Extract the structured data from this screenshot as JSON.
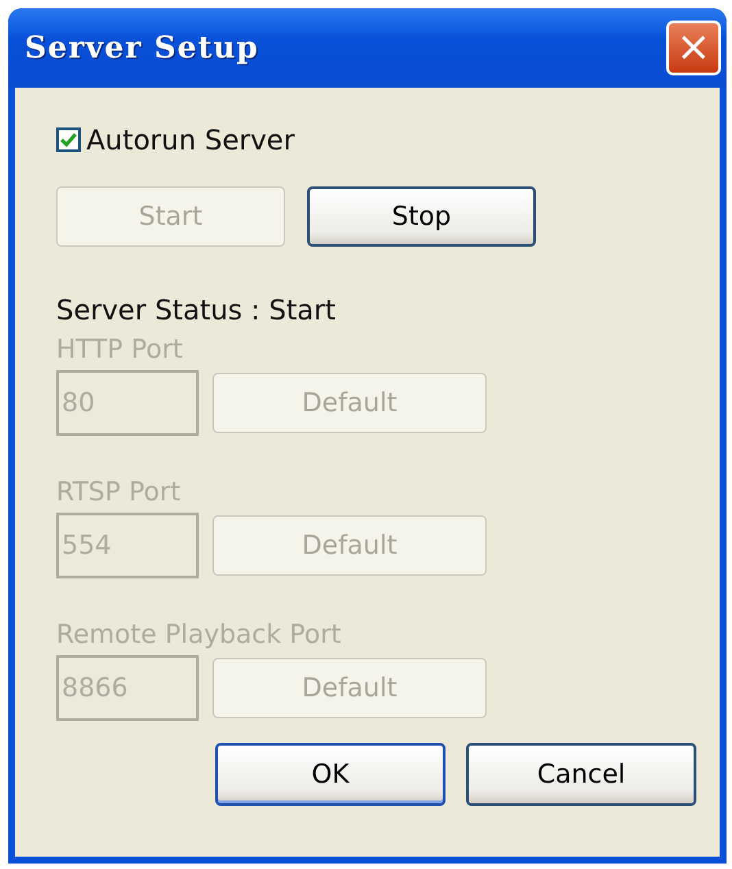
{
  "window": {
    "title": "Server Setup",
    "close_button": "×"
  },
  "autorun": {
    "label": "Autorun Server",
    "checked": true
  },
  "server_buttons": [
    {
      "label": "Start",
      "disabled": true
    },
    {
      "label": "Stop",
      "disabled": false
    }
  ],
  "status": "Server Status : Start",
  "ports": [
    {
      "label": "HTTP Port",
      "value": "80",
      "button": "Default",
      "disabled": true
    },
    {
      "label": "RTSP Port",
      "value": "554",
      "button": "Default",
      "disabled": true
    },
    {
      "label": "Remote Playback Port",
      "value": "8866",
      "button": "Default",
      "disabled": true
    }
  ],
  "buttons": [
    {
      "label": "OK",
      "default": true
    },
    {
      "label": "Cancel",
      "default": false
    }
  ]
}
